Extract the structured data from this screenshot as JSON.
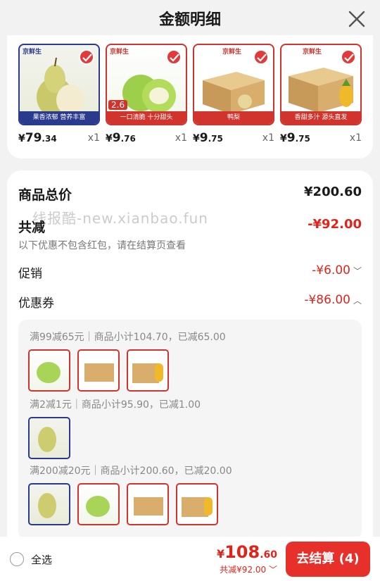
{
  "header": {
    "title": "金额明细"
  },
  "products": [
    {
      "currency": "¥",
      "int": "79",
      "dec": ".34",
      "qty": "x1",
      "brand": "京鲜生",
      "banner": "果香浓郁 营养丰富",
      "icon": "pear-icon"
    },
    {
      "currency": "¥",
      "int": "9",
      "dec": ".76",
      "qty": "x1",
      "brand": "京鲜生",
      "banner": "一口清脆 十分甜头",
      "badge": "2.6",
      "icon": "apple-icon"
    },
    {
      "currency": "¥",
      "int": "9",
      "dec": ".75",
      "qty": "x1",
      "brand": "京鲜生",
      "banner": "鸭梨",
      "icon": "box-icon"
    },
    {
      "currency": "¥",
      "int": "9",
      "dec": ".75",
      "qty": "x1",
      "brand": "京鲜生",
      "banner": "香甜多汁 源头直发",
      "icon": "box-icon"
    }
  ],
  "summary": {
    "total_label": "商品总价",
    "total_value": "¥200.60",
    "reduce_label": "共减",
    "reduce_value": "-¥92.00",
    "note": "以下优惠不包含红包，请在结算页查看",
    "promo_label": "促销",
    "promo_value": "-¥6.00",
    "coupon_label": "优惠券",
    "coupon_value": "-¥86.00"
  },
  "watermark": "线报酷-new.xianbao.fun",
  "coupon_groups": [
    {
      "text": "满99减65元｜商品小计104.70，已减65.00"
    },
    {
      "text": "满2减1元｜商品小计95.90，已减1.00"
    },
    {
      "text": "满200减20元｜商品小计200.60，已减20.00"
    }
  ],
  "bottom": {
    "select_all": "全选",
    "cur": "¥",
    "int": "108",
    "dec": ".60",
    "saved": "共减¥92.00",
    "checkout": "去结算 (4)"
  },
  "colors": {
    "accent": "#e2231a",
    "button": "#e8302a"
  }
}
